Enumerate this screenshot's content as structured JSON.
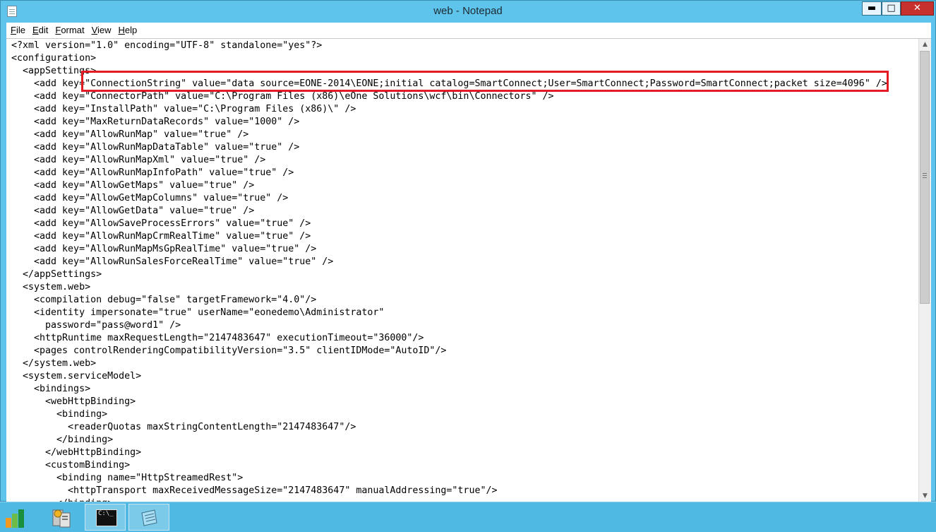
{
  "window": {
    "title": "web - Notepad",
    "minimize_label": "▬",
    "maximize_label": "□",
    "close_label": "✕"
  },
  "menu": {
    "file": {
      "key": "F",
      "rest": "ile"
    },
    "edit": {
      "key": "E",
      "rest": "dit"
    },
    "format": {
      "key": "F",
      "rest": "ormat"
    },
    "view": {
      "key": "V",
      "rest": "iew"
    },
    "help": {
      "key": "H",
      "rest": "elp"
    }
  },
  "document": {
    "lines": [
      "<?xml version=\"1.0\" encoding=\"UTF-8\" standalone=\"yes\"?>",
      "<configuration>",
      "  <appSettings>",
      "    <add key=\"ConnectionString\" value=\"data source=EONE-2014\\EONE;initial catalog=SmartConnect;User=SmartConnect;Password=SmartConnect;packet size=4096\" />",
      "    <add key=\"ConnectorPath\" value=\"C:\\Program Files (x86)\\eOne Solutions\\wcf\\bin\\Connectors\" />",
      "    <add key=\"InstallPath\" value=\"C:\\Program Files (x86)\\\" />",
      "    <add key=\"MaxReturnDataRecords\" value=\"1000\" />",
      "    <add key=\"AllowRunMap\" value=\"true\" />",
      "    <add key=\"AllowRunMapDataTable\" value=\"true\" />",
      "    <add key=\"AllowRunMapXml\" value=\"true\" />",
      "    <add key=\"AllowRunMapInfoPath\" value=\"true\" />",
      "    <add key=\"AllowGetMaps\" value=\"true\" />",
      "    <add key=\"AllowGetMapColumns\" value=\"true\" />",
      "    <add key=\"AllowGetData\" value=\"true\" />",
      "    <add key=\"AllowSaveProcessErrors\" value=\"true\" />",
      "    <add key=\"AllowRunMapCrmRealTime\" value=\"true\" />",
      "    <add key=\"AllowRunMapMsGpRealTime\" value=\"true\" />",
      "    <add key=\"AllowRunSalesForceRealTime\" value=\"true\" />",
      "  </appSettings>",
      "  <system.web>",
      "    <compilation debug=\"false\" targetFramework=\"4.0\"/>",
      "    <identity impersonate=\"true\" userName=\"eonedemo\\Administrator\"",
      "      password=\"pass@word1\" />",
      "    <httpRuntime maxRequestLength=\"2147483647\" executionTimeout=\"36000\"/>",
      "    <pages controlRenderingCompatibilityVersion=\"3.5\" clientIDMode=\"AutoID\"/>",
      "  </system.web>",
      "  <system.serviceModel>",
      "    <bindings>",
      "      <webHttpBinding>",
      "        <binding>",
      "          <readerQuotas maxStringContentLength=\"2147483647\"/>",
      "        </binding>",
      "      </webHttpBinding>",
      "      <customBinding>",
      "        <binding name=\"HttpStreamedRest\">",
      "          <httpTransport maxReceivedMessageSize=\"2147483647\" manualAddressing=\"true\"/>",
      "        </binding>"
    ]
  },
  "taskbar": {
    "cmd_label": "C:\\_"
  },
  "colors": {
    "window_frame": "#5fc4eb",
    "highlight_box": "#e21b24",
    "close_button": "#c7312d",
    "taskbar": "#4fb8e3"
  }
}
